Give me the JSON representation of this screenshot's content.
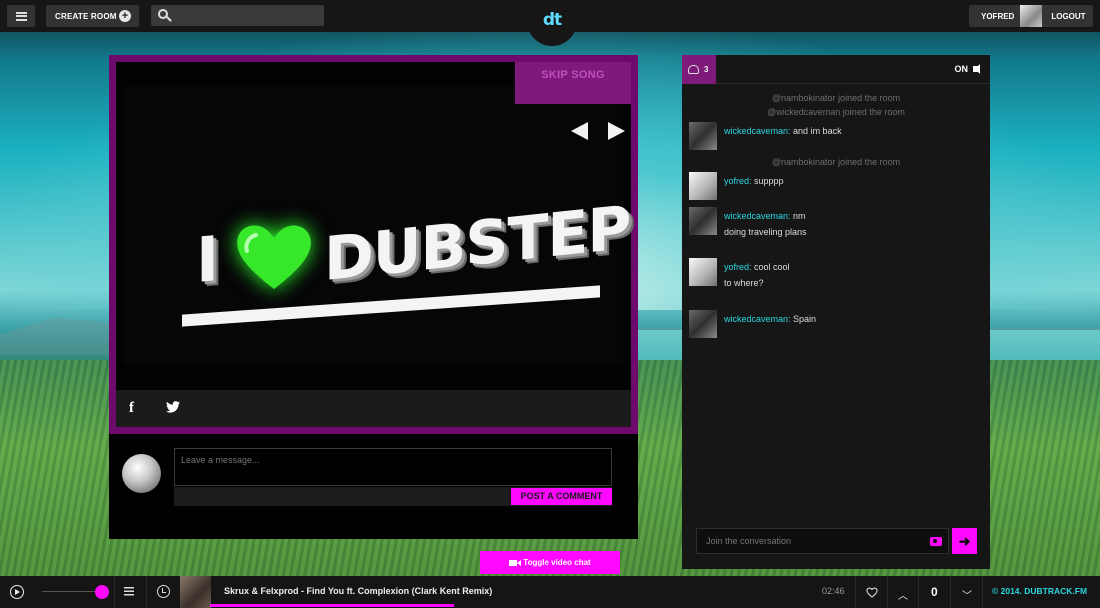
{
  "topbar": {
    "create_room_label": "CREATE ROOM",
    "search_placeholder": "",
    "logo_text": "dt",
    "username": "YOFRED",
    "logout_label": "LOGOUT"
  },
  "player": {
    "skip_song_label": "SKIP SONG",
    "video_text_i": "I",
    "video_text_dubstep": "DUBSTEP",
    "facebook_icon": "f",
    "twitter_icon": "twitter-icon"
  },
  "comment": {
    "placeholder": "Leave a message...",
    "post_label": "POST A COMMENT"
  },
  "toggle_video_chat_label": "Toggle video chat",
  "chat": {
    "users_count": "3",
    "sound_label": "ON",
    "system_messages": [
      "@nambokinator joined the room",
      "@wickedcaveman joined the room",
      "@nambokinator joined the room"
    ],
    "messages": [
      {
        "user": "wickedcaveman:",
        "lines": [
          "and im back"
        ]
      },
      {
        "user": "yofred:",
        "lines": [
          "supppp"
        ]
      },
      {
        "user": "wickedcaveman:",
        "lines": [
          "nm",
          "doing traveling plans"
        ]
      },
      {
        "user": "yofred:",
        "lines": [
          "cool cool",
          "to where?"
        ]
      },
      {
        "user": "wickedcaveman:",
        "lines": [
          "Spain"
        ]
      }
    ],
    "input_placeholder": "Join the conversation"
  },
  "bottombar": {
    "track_title": "Skrux & Felxprod - Find You ft. Complexion (Clark Kent Remix)",
    "track_time": "02:46",
    "vote_count": "0",
    "copyright": "© 2014. DUBTRACK.FM",
    "progress_fraction": 0.42,
    "volume_fraction": 1.0
  },
  "colors": {
    "accent_magenta": "#ff08ff",
    "accent_cyan": "#2bd7e0",
    "panel_purple": "#6e0a6b"
  }
}
